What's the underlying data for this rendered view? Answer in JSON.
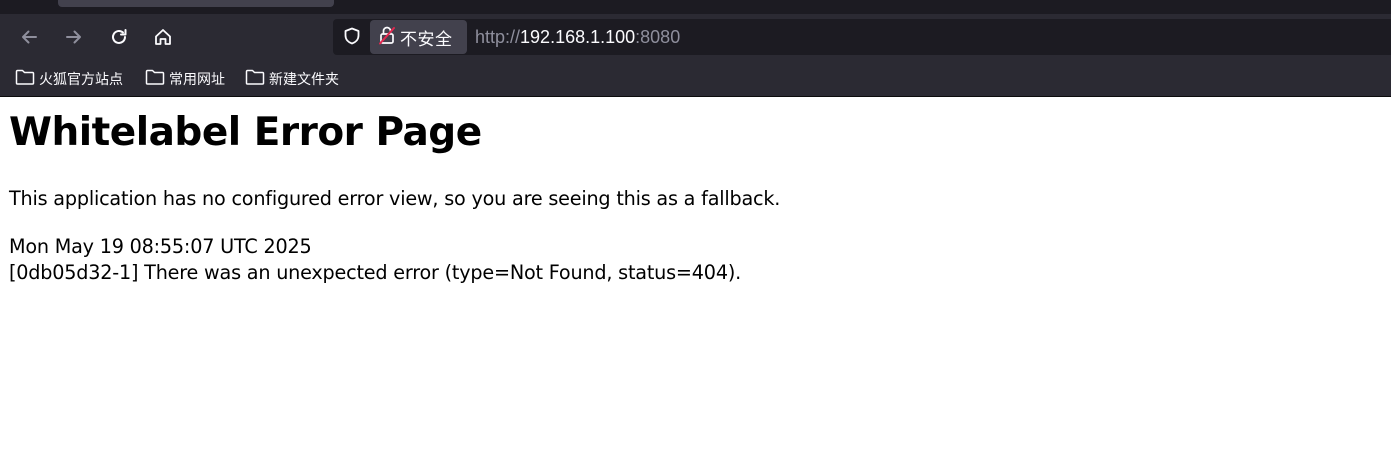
{
  "browser": {
    "url": {
      "scheme": "http://",
      "host": "192.168.1.100",
      "port": ":8080"
    },
    "security_label": "不安全",
    "icons": [
      "back-arrow-icon",
      "forward-arrow-icon",
      "reload-icon",
      "home-icon",
      "shield-icon",
      "insecure-lock-icon",
      "folder-icon"
    ],
    "bookmarks": [
      {
        "label": "火狐官方站点"
      },
      {
        "label": "常用网址"
      },
      {
        "label": "新建文件夹"
      }
    ]
  },
  "page": {
    "title": "Whitelabel Error Page",
    "message": "This application has no configured error view, so you are seeing this as a fallback.",
    "timestamp": "Mon May 19 08:55:07 UTC 2025",
    "error": "[0db05d32-1] There was an unexpected error (type=Not Found, status=404)."
  }
}
